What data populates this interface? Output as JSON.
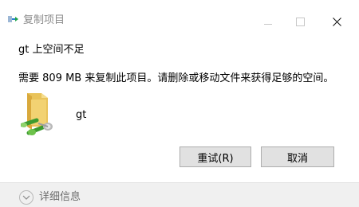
{
  "window": {
    "title": "复制项目",
    "minimize_icon": "minimize-icon",
    "maximize_icon": "maximize-icon",
    "close_icon": "close-icon"
  },
  "dialog": {
    "heading": "gt 上空间不足",
    "message": "需要 809 MB 来复制此项目。请删除或移动文件来获得足够的空间。",
    "item": {
      "icon": "network-folder-icon",
      "name": "gt"
    }
  },
  "buttons": {
    "retry_label": "重试(R)",
    "cancel_label": "取消"
  },
  "footer": {
    "details_label": "详细信息",
    "details_icon": "chevron-down-icon"
  },
  "colors": {
    "button_bg": "#e1e1e1",
    "button_border": "#adadad",
    "footer_bg": "#f0f0f0",
    "title_text": "#8c8c8c"
  }
}
